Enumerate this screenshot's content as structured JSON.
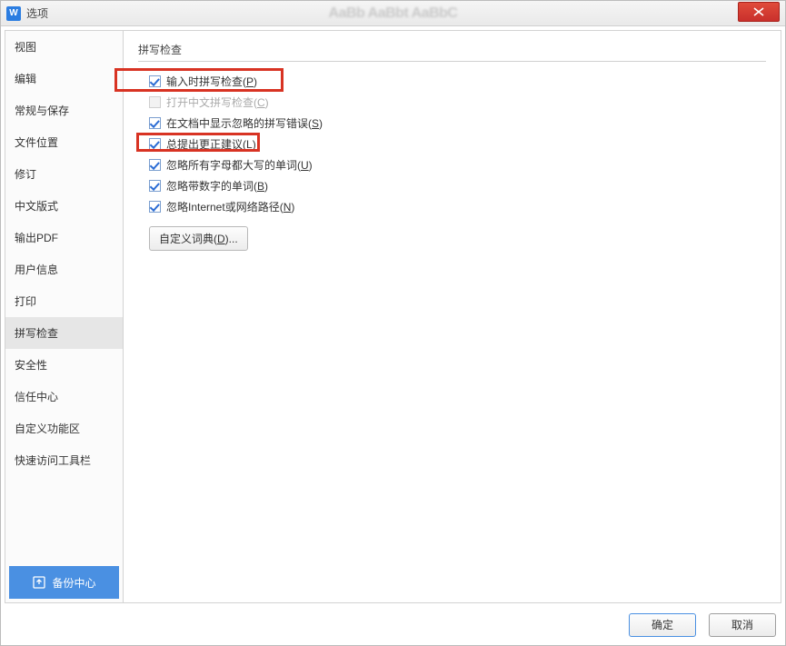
{
  "titlebar": {
    "icon_letter": "W",
    "title": "选项",
    "background_blur": "AaBb AaBbt AaBbC"
  },
  "sidebar": {
    "items": [
      {
        "label": "视图",
        "selected": false
      },
      {
        "label": "编辑",
        "selected": false
      },
      {
        "label": "常规与保存",
        "selected": false
      },
      {
        "label": "文件位置",
        "selected": false
      },
      {
        "label": "修订",
        "selected": false
      },
      {
        "label": "中文版式",
        "selected": false
      },
      {
        "label": "输出PDF",
        "selected": false
      },
      {
        "label": "用户信息",
        "selected": false
      },
      {
        "label": "打印",
        "selected": false
      },
      {
        "label": "拼写检查",
        "selected": true
      },
      {
        "label": "安全性",
        "selected": false
      },
      {
        "label": "信任中心",
        "selected": false
      },
      {
        "label": "自定义功能区",
        "selected": false
      },
      {
        "label": "快速访问工具栏",
        "selected": false
      }
    ],
    "backup_center": "备份中心"
  },
  "section": {
    "header": "拼写检查",
    "options": [
      {
        "label_pre": "输入时拼写检查(",
        "accel": "P",
        "label_post": ")",
        "checked": true,
        "disabled": false,
        "highlight": "hl1"
      },
      {
        "label_pre": "打开中文拼写检查(",
        "accel": "C",
        "label_post": ")",
        "checked": false,
        "disabled": true,
        "highlight": null
      },
      {
        "label_pre": "在文档中显示忽略的拼写错误(",
        "accel": "S",
        "label_post": ")",
        "checked": true,
        "disabled": false,
        "highlight": null
      },
      {
        "label_pre": "总提出更正建议(",
        "accel": "L",
        "label_post": ")",
        "checked": true,
        "disabled": false,
        "highlight": "hl4"
      },
      {
        "label_pre": "忽略所有字母都大写的单词(",
        "accel": "U",
        "label_post": ")",
        "checked": true,
        "disabled": false,
        "highlight": null
      },
      {
        "label_pre": "忽略带数字的单词(",
        "accel": "B",
        "label_post": ")",
        "checked": true,
        "disabled": false,
        "highlight": null
      },
      {
        "label_pre": "忽略Internet或网络路径(",
        "accel": "N",
        "label_post": ")",
        "checked": true,
        "disabled": false,
        "highlight": null
      }
    ],
    "custom_dict_pre": "自定义词典(",
    "custom_dict_accel": "D",
    "custom_dict_post": ")..."
  },
  "footer": {
    "ok": "确定",
    "cancel": "取消"
  }
}
